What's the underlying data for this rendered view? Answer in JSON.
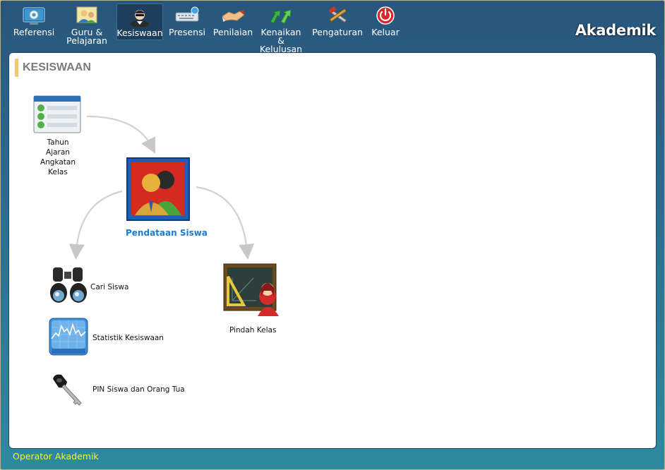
{
  "brand": "Akademik",
  "toolbar": {
    "items": [
      {
        "label": "Referensi",
        "icon": "gear-screen-icon"
      },
      {
        "label": "Guru &\nPelajaran",
        "icon": "teachers-icon"
      },
      {
        "label": "Kesiswaan",
        "icon": "student-icon",
        "active": true
      },
      {
        "label": "Presensi",
        "icon": "keyboard-icon"
      },
      {
        "label": "Penilaian",
        "icon": "handshake-icon"
      },
      {
        "label": "Kenaikan &\nKelulusan",
        "icon": "green-arrows-icon"
      },
      {
        "label": "Pengaturan",
        "icon": "tools-icon"
      },
      {
        "label": "Keluar",
        "icon": "power-icon"
      }
    ]
  },
  "section": {
    "title": "KESISWAAN"
  },
  "nodes": {
    "tahun": {
      "label": "Tahun Ajaran\nAngkatan\nKelas",
      "icon": "checklist-icon"
    },
    "pendataan": {
      "label": "Pendataan Siswa",
      "icon": "students-photo-icon"
    },
    "cari": {
      "label": "Cari Siswa",
      "icon": "binoculars-icon"
    },
    "statistik": {
      "label": "Statistik Kesiswaan",
      "icon": "chart-icon"
    },
    "pin": {
      "label": "PIN Siswa dan Orang Tua",
      "icon": "key-icon"
    },
    "pindah": {
      "label": "Pindah Kelas",
      "icon": "classroom-icon"
    }
  },
  "footer": {
    "user": "Operator Akademik"
  },
  "colors": {
    "header_bg": "#28567a",
    "panel_bg": "#ffffff",
    "accent_link": "#1b7bd0",
    "footer_text": "#f4f43c",
    "section_bar": "#f4c86a"
  }
}
